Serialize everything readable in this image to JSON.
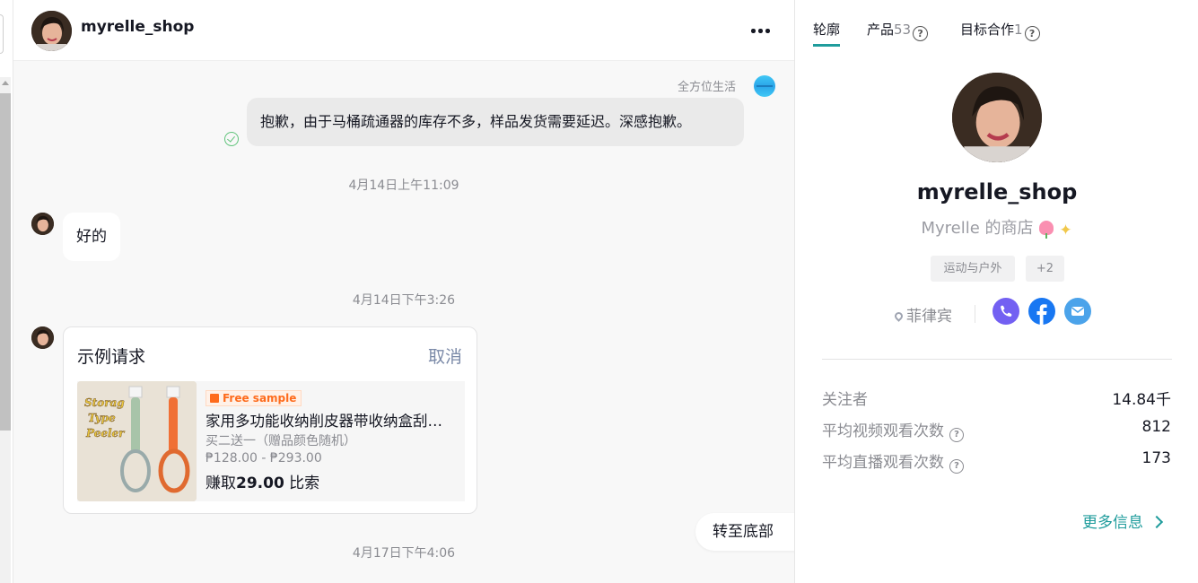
{
  "chat": {
    "header": {
      "username": "myrelle_shop"
    },
    "messages": {
      "outgoing_sender": "全方位生活",
      "outgoing_text": "抱歉，由于马桶疏通器的库存不多，样品发货需要延迟。深感抱歉。",
      "ts1": "4月14日上午11:09",
      "incoming_text": "好的",
      "ts2": "4月14日下午3:26",
      "ts3": "4月17日下午4:06"
    },
    "sample_card": {
      "title": "示例请求",
      "cancel_label": "取消",
      "product_image_text": [
        "Storag",
        "Type",
        "Peeler"
      ],
      "badge": "Free sample",
      "product_name": "家用多功能收纳削皮器带收纳盒刮…",
      "subtitle": "买二送一（赠品颜色随机）",
      "price_range": "₱128.00 - ₱293.00",
      "earn_prefix": "赚取",
      "earn_amount": "29.00",
      "earn_suffix": " 比索"
    },
    "scroll_bottom_label": "转至底部"
  },
  "profile": {
    "tabs": [
      {
        "label": "轮廓",
        "count": ""
      },
      {
        "label": "产品",
        "count": "53"
      },
      {
        "label": "目标合作",
        "count": "1"
      }
    ],
    "username": "myrelle_shop",
    "shop_name": "Myrelle 的商店",
    "tags": [
      "运动与户外",
      "+2"
    ],
    "location": "菲律宾",
    "stats": [
      {
        "label": "关注者",
        "value": "14.84千"
      },
      {
        "label": "平均视频观看次数",
        "value": "812"
      },
      {
        "label": "平均直播观看次数",
        "value": "173"
      }
    ],
    "more_info": "更多信息"
  },
  "colors": {
    "accent": "#1f9c9c",
    "badge": "#fe6b1c",
    "viber": "#7360f2",
    "facebook": "#1877f2",
    "mail": "#4ba3ea"
  }
}
